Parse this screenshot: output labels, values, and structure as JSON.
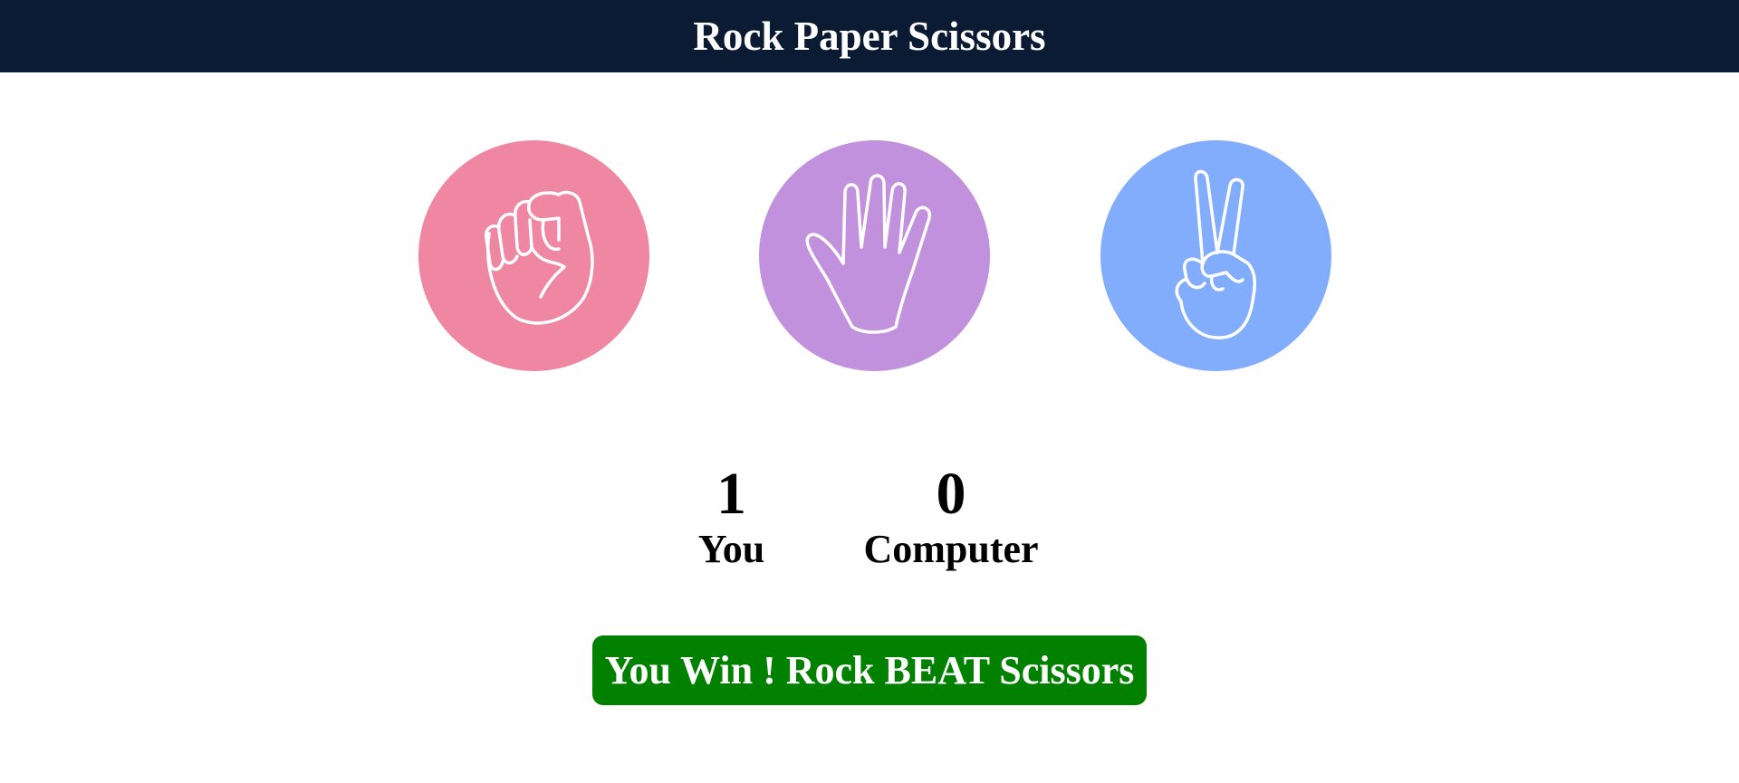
{
  "header": {
    "title": "Rock Paper Scissors",
    "background": "#0a1b33"
  },
  "choices": [
    {
      "name": "rock",
      "icon": "fist-icon",
      "color": "#f087a2"
    },
    {
      "name": "paper",
      "icon": "open-hand-icon",
      "color": "#c291dd"
    },
    {
      "name": "scissors",
      "icon": "peace-hand-icon",
      "color": "#82adfd"
    }
  ],
  "scores": {
    "user": {
      "value": "1",
      "label": "You"
    },
    "computer": {
      "value": "0",
      "label": "Computer"
    }
  },
  "result": {
    "message": "You Win ! Rock BEAT Scissors",
    "color": "#028101"
  }
}
